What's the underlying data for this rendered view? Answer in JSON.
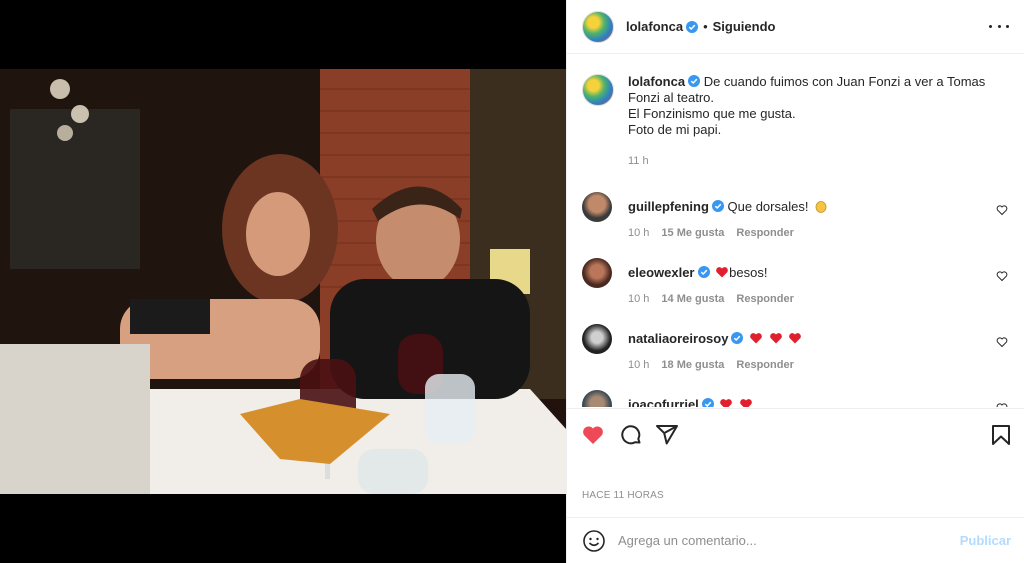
{
  "header": {
    "username": "lolafonca",
    "separator": "•",
    "follow_status": "Siguiendo",
    "icons": {
      "avatar": "avatar",
      "verified": "verified-badge-icon",
      "more": "more-options-icon"
    }
  },
  "caption": {
    "username": "lolafonca",
    "text": "De cuando fuimos con Juan Fonzi a ver a Tomas Fonzi al teatro.\nEl Fonzinismo que me gusta.\nFoto de mi papi.",
    "time": "11 h"
  },
  "comments": [
    {
      "username": "guillepfening",
      "text": "Que dorsales!",
      "emoji": "clapping-hands-emoji",
      "time": "10 h",
      "likes": "15 Me gusta",
      "reply": "Responder"
    },
    {
      "username": "eleowexler",
      "text": "besos!",
      "emoji_before": "red-heart-emoji",
      "time": "10 h",
      "likes": "14 Me gusta",
      "reply": "Responder"
    },
    {
      "username": "nataliaoreirosoy",
      "text": "",
      "emoji_count": 3,
      "emoji": "red-heart-emoji",
      "time": "10 h",
      "likes": "18 Me gusta",
      "reply": "Responder"
    },
    {
      "username": "joacofurriel",
      "text": "",
      "emoji_count": 2,
      "emoji": "red-heart-emoji"
    }
  ],
  "actions": {
    "like_icon": "heart-filled-icon",
    "comment_icon": "comment-icon",
    "share_icon": "share-icon",
    "save_icon": "bookmark-icon",
    "like_color": "#ed4956"
  },
  "time_label": "HACE 11 HORAS",
  "add_comment": {
    "placeholder": "Agrega un comentario...",
    "post_label": "Publicar"
  },
  "colors": {
    "verified": "#3897f0",
    "muted": "#8e8e8e",
    "text": "#262626",
    "post_disabled": "#b3dbff"
  }
}
